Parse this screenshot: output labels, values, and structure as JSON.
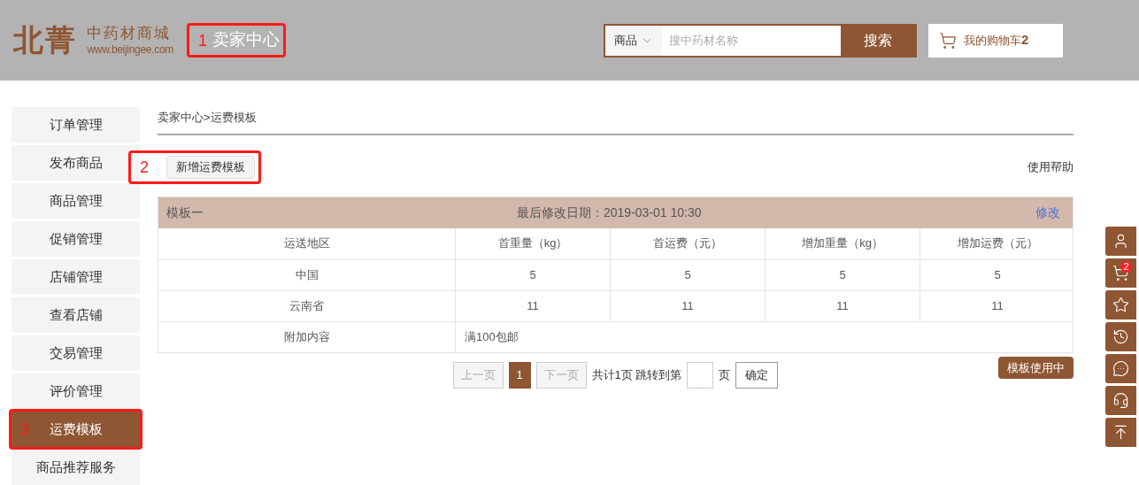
{
  "header": {
    "logo_mark": "北菁",
    "logo_title": "中药材商城",
    "logo_url": "www.beijingee.com",
    "seller_center": {
      "label": "卖家中心",
      "annotation": "1"
    },
    "search": {
      "category": "商品",
      "placeholder": "搜中药材名称",
      "button": "搜索"
    },
    "cart": {
      "label": "我的购物车",
      "count": "2"
    }
  },
  "sidebar": {
    "items": [
      {
        "label": "订单管理",
        "selected": false
      },
      {
        "label": "发布商品",
        "selected": false
      },
      {
        "label": "商品管理",
        "selected": false
      },
      {
        "label": "促销管理",
        "selected": false
      },
      {
        "label": "店铺管理",
        "selected": false
      },
      {
        "label": "查看店铺",
        "selected": false
      },
      {
        "label": "交易管理",
        "selected": false
      },
      {
        "label": "评价管理",
        "selected": false
      },
      {
        "label": "运费模板",
        "selected": true,
        "annotation": "3"
      },
      {
        "label": "商品推荐服务",
        "selected": false
      }
    ]
  },
  "breadcrumb": "卖家中心>运费模板",
  "add_button": {
    "label": "新增运费模板",
    "annotation": "2"
  },
  "help_link": "使用帮助",
  "template": {
    "name": "模板一",
    "modified": "最后修改日期：2019-03-01 10:30",
    "edit_link": "修改",
    "columns": [
      "运送地区",
      "首重量（kg）",
      "首运费（元）",
      "增加重量（kg）",
      "增加运费（元）"
    ],
    "rows": [
      [
        "中国",
        "5",
        "5",
        "5",
        "5"
      ],
      [
        "云南省",
        "11",
        "11",
        "11",
        "11"
      ]
    ],
    "extra_label": "附加内容",
    "extra_value": "满100包邮"
  },
  "pagination": {
    "prev": {
      "label": "上一页",
      "disabled": true
    },
    "pages": [
      {
        "label": "1",
        "selected": true
      }
    ],
    "next": {
      "label": "下一页",
      "disabled": true
    },
    "total": "共计1页 跳转到第",
    "page_unit": "页",
    "confirm": "确定"
  },
  "status_badge": "模板使用中",
  "float_bar": [
    {
      "kind": "user"
    },
    {
      "kind": "cart",
      "badge": "2"
    },
    {
      "kind": "star"
    },
    {
      "kind": "history"
    },
    {
      "kind": "chat"
    },
    {
      "kind": "headset"
    },
    {
      "kind": "top"
    }
  ]
}
